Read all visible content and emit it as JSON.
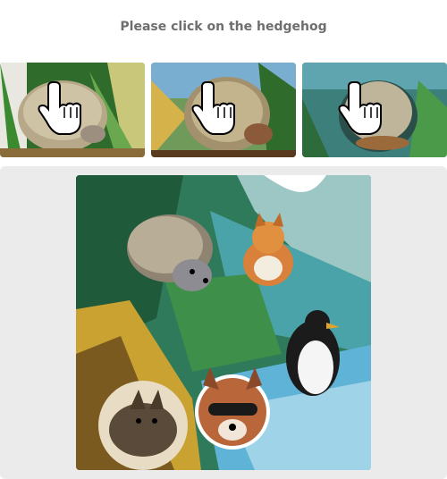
{
  "prompt": "Please click on the hedgehog",
  "examples": [
    {
      "name": "example-1",
      "icon": "hand-pointer-icon"
    },
    {
      "name": "example-2",
      "icon": "hand-pointer-icon"
    },
    {
      "name": "example-3",
      "icon": "hand-pointer-icon"
    }
  ],
  "scene": {
    "animals": [
      "hedgehog",
      "cat",
      "penguin",
      "raccoon",
      "bat"
    ]
  },
  "colors": {
    "panel": "#ebebeb",
    "prompt_text": "#6e6e6e"
  }
}
